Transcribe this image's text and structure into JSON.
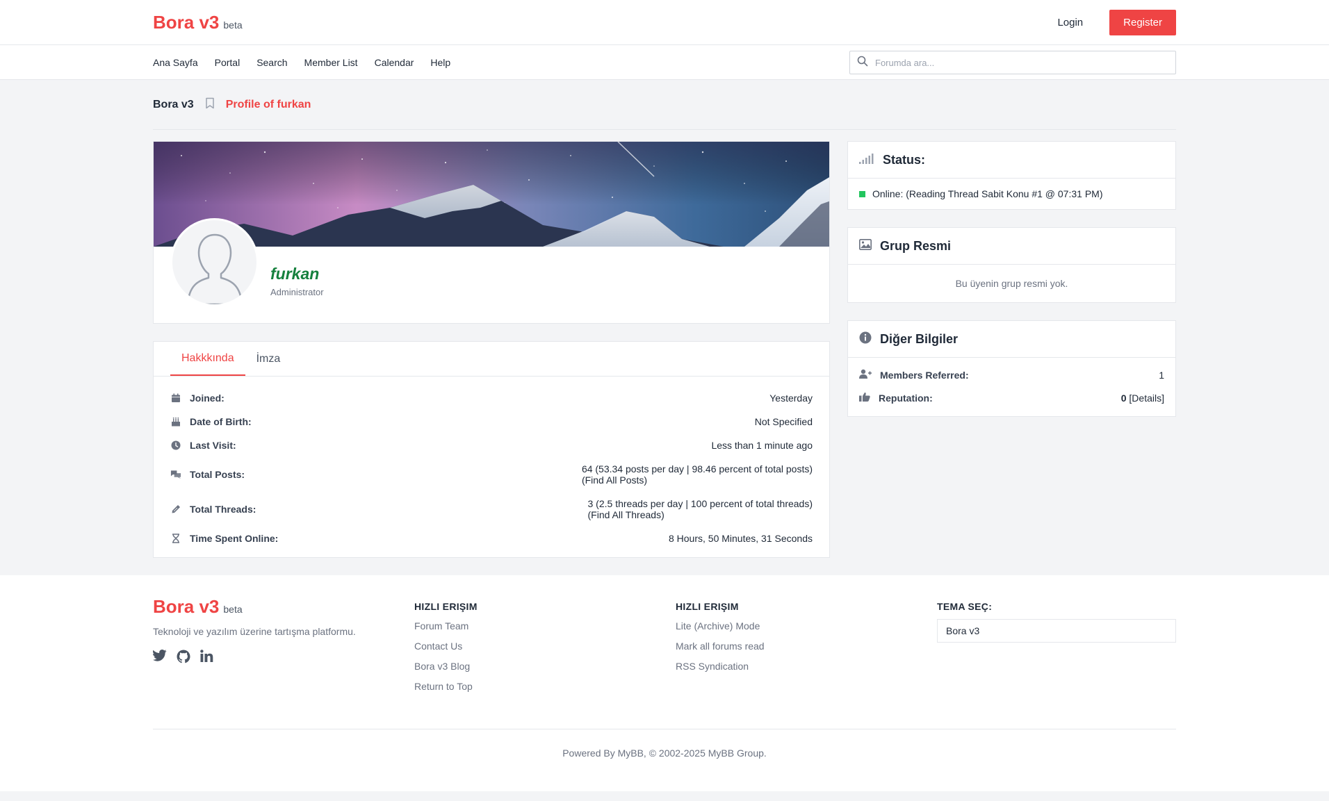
{
  "header": {
    "logo": "Bora v3",
    "logo_badge": "beta",
    "login_label": "Login",
    "register_label": "Register"
  },
  "nav": {
    "links": [
      "Ana Sayfa",
      "Portal",
      "Search",
      "Member List",
      "Calendar",
      "Help"
    ],
    "search_placeholder": "Forumda ara..."
  },
  "breadcrumb": {
    "home": "Bora v3",
    "current": "Profile of furkan"
  },
  "profile": {
    "username": "furkan",
    "role": "Administrator",
    "username_color": "#15803d"
  },
  "tabs": [
    "Hakkkında",
    "İmza"
  ],
  "about": {
    "joined_label": "Joined:",
    "joined_value": "Yesterday",
    "dob_label": "Date of Birth:",
    "dob_value": "Not Specified",
    "last_visit_label": "Last Visit:",
    "last_visit_value": "Less than 1 minute ago",
    "total_posts_label": "Total Posts:",
    "total_posts_value": "64 (53.34 posts per day | 98.46 percent of total posts)",
    "find_all_posts": "(Find All Posts)",
    "total_threads_label": "Total Threads:",
    "total_threads_value": "3 (2.5 threads per day | 100 percent of total threads)",
    "find_all_threads": "(Find All Threads)",
    "time_online_label": "Time Spent Online:",
    "time_online_value": "8 Hours, 50 Minutes, 31 Seconds"
  },
  "status_card": {
    "title": "Status:",
    "text": "Online: (Reading Thread Sabit Konu #1 @ 07:31 PM)"
  },
  "group_card": {
    "title": "Grup Resmi",
    "empty_text": "Bu üyenin grup resmi yok."
  },
  "other_card": {
    "title": "Diğer Bilgiler",
    "referred_label": "Members Referred:",
    "referred_value": "1",
    "reputation_label": "Reputation:",
    "reputation_value": "0",
    "reputation_details": "[Details]"
  },
  "footer": {
    "logo": "Bora v3",
    "logo_badge": "beta",
    "description": "Teknoloji ve yazılım üzerine tartışma platformu.",
    "col1_heading": "HIZLI ERIŞIM",
    "col1_links": [
      "Forum Team",
      "Contact Us",
      "Bora v3 Blog",
      "Return to Top"
    ],
    "col2_heading": "HIZLI ERIŞIM",
    "col2_links": [
      "Lite (Archive) Mode",
      "Mark all forums read",
      "RSS Syndication"
    ],
    "theme_heading": "TEMA SEÇ:",
    "theme_value": "Bora v3",
    "copyright": "Powered By MyBB, © 2002-2025 MyBB Group."
  },
  "colors": {
    "accent": "#ef4444",
    "online": "#22c55e"
  }
}
